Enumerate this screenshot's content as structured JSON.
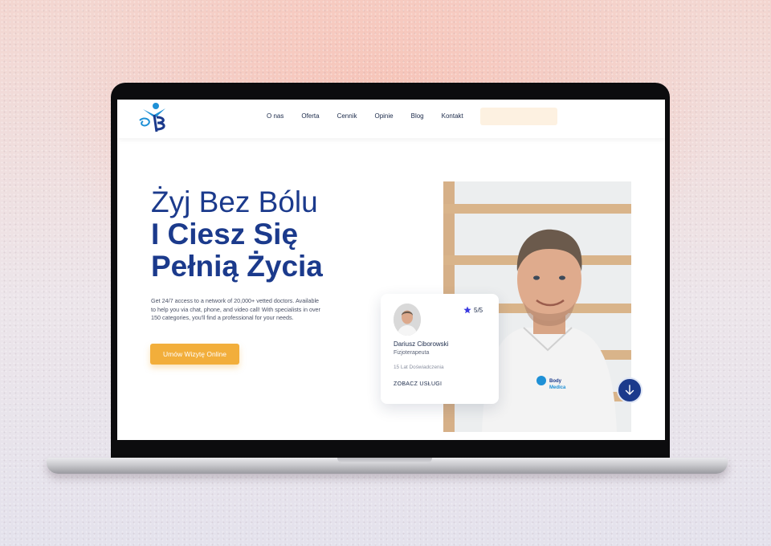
{
  "colors": {
    "brand_blue": "#1b3a8c",
    "accent_orange": "#f2ae3b",
    "cta_bg": "#fdf1e1"
  },
  "nav": {
    "logo_icon": "body-medica-logo",
    "links": [
      "O nas",
      "Oferta",
      "Cennik",
      "Opinie",
      "Blog",
      "Kontakt"
    ],
    "cta_label": ""
  },
  "hero": {
    "title_line1": "Żyj Bez Bólu",
    "title_line2": "I Ciesz Się",
    "title_line3": "Pełnią Życia",
    "description": "Get 24/7 access to a network of 20,000+ vetted doctors. Available to help you via chat, phone, and video call! With specialists in over 150 categories, you'll find a professional for your needs.",
    "button_label": "Umów Wizytę Online"
  },
  "doctor_card": {
    "rating_icon": "star-icon",
    "rating": "5/5",
    "name": "Dariusz Ciborowski",
    "role": "Fizjoterapeuta",
    "experience": "15 Lat Doświadczenia",
    "link_label": "ZOBACZ USŁUGI"
  },
  "scroll_button_icon": "arrow-down-icon"
}
